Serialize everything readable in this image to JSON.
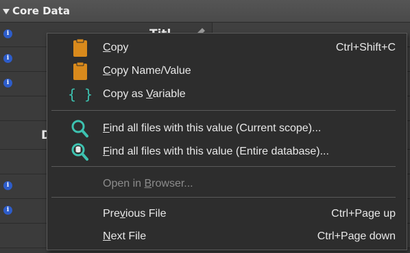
{
  "panel": {
    "title": "Core Data"
  },
  "background": {
    "labels": {
      "title_partial": "Titl",
      "d_partial": "D"
    }
  },
  "menu": {
    "copy": {
      "pre": "",
      "ul": "C",
      "post": "opy",
      "shortcut": "Ctrl+Shift+C",
      "icon": "clipboard-icon"
    },
    "copy_name_value": {
      "pre": "",
      "ul": "C",
      "post": "opy Name/Value",
      "icon": "clipboard-icon"
    },
    "copy_variable": {
      "pre": "Copy as ",
      "ul": "V",
      "post": "ariable",
      "icon": "curly-braces-icon"
    },
    "find_current": {
      "pre": "",
      "ul": "F",
      "post": "ind all files with this value (Current scope)...",
      "icon": "magnifier-icon"
    },
    "find_entire": {
      "pre": "",
      "ul": "F",
      "post": "ind all files with this value (Entire database)...",
      "icon": "database-magnifier-icon"
    },
    "open_browser": {
      "pre": "Open in ",
      "ul": "B",
      "post": "rowser..."
    },
    "previous_file": {
      "pre": "Pre",
      "ul": "v",
      "post": "ious File",
      "shortcut": "Ctrl+Page up"
    },
    "next_file": {
      "pre": "",
      "ul": "N",
      "post": "ext File",
      "shortcut": "Ctrl+Page down"
    }
  },
  "colors": {
    "clipboard": "#d98a1c",
    "teal": "#3dc2b0",
    "info": "#2d5cc9"
  }
}
